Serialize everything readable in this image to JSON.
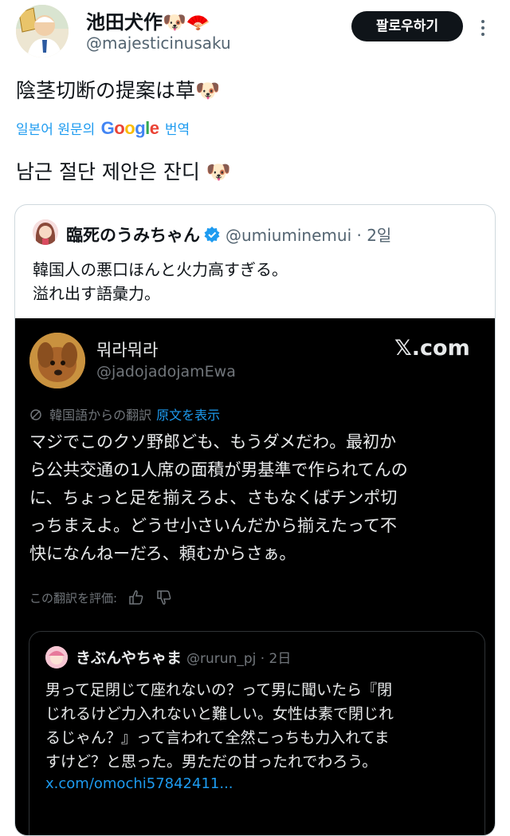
{
  "author": {
    "display_name": "池田犬作🐶🪭",
    "handle": "@majesticinusaku"
  },
  "header": {
    "follow_label": "팔로우하기",
    "more_icon": "more-vertical-icon"
  },
  "tweet": {
    "text": "陰茎切断の提案は草🐶",
    "translate_prefix": "일본어 원문의",
    "translate_google": "Google",
    "translate_suffix": "번역",
    "translated_text": "남근 절단 제안은 잔디 🐶"
  },
  "quote": {
    "name": "臨死のうみちゃん",
    "handle": "@umiuminemui · 2일",
    "text": "韓国人の悪口ほんと火力高すぎる。\n溢れ出す語彙力。",
    "verified_icon": "verified-badge-icon"
  },
  "screenshot": {
    "name": "뭐라뭐라",
    "handle": "@jadojadojamEwa",
    "brand": "𝕏.com",
    "translation_note": "韓国語からの翻訳",
    "show_original": "原文を表示",
    "text": "マジでこのクソ野郎ども、もうダメだわ。最初か\nら公共交通の1人席の面積が男基準で作られてんの\nに、ちょっと足を揃えろよ、さもなくばチンポ切\nっちまえよ。どうせ小さいんだから揃えたって不\n快になんねーだろ、頼むからさぁ。",
    "rate_label": "この翻訳を評価:",
    "inner_quote": {
      "name": "きぶんやちゃま",
      "handle": "@rurun_pj · 2日",
      "text": "男って足閉じて座れないの？って男に聞いたら『閉\nじれるけど力入れないと難しい。女性は素で閉じれ\nるじゃん？』って言われて全然こっちも力入れてま\nすけど？と思った。男ただの甘ったれでわろう。",
      "link": "x.com/omochi57842411..."
    }
  },
  "colors": {
    "accent": "#1d9bf0",
    "text": "#0f1419",
    "muted": "#536471",
    "dark_bg": "#000000"
  }
}
